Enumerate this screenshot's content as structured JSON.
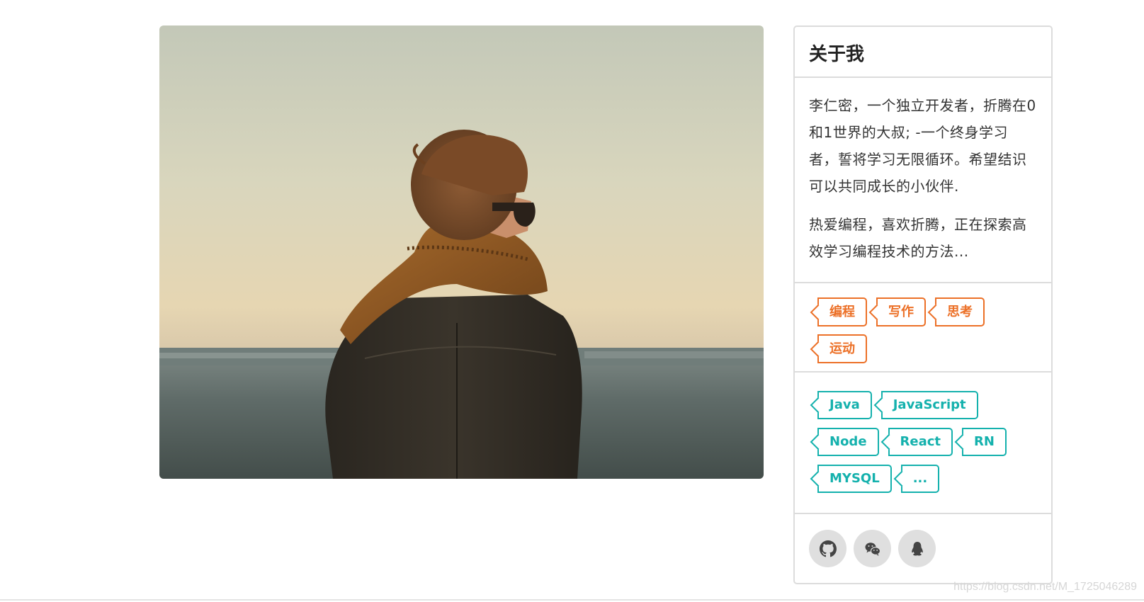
{
  "about": {
    "title": "关于我",
    "paragraphs": [
      "李仁密，一个独立开发者，折腾在0和1世界的大叔; -一个终身学习者，誓将学习无限循环。希望结识可以共同成长的小伙伴.",
      "热爱编程，喜欢折腾，正在探索高效学习编程技术的方法..."
    ]
  },
  "interest_tags": [
    "编程",
    "写作",
    "思考",
    "运动"
  ],
  "tech_tags": [
    "Java",
    "JavaScript",
    "Node",
    "React",
    "RN",
    "MYSQL",
    "..."
  ],
  "social": [
    {
      "icon": "github-icon"
    },
    {
      "icon": "wechat-icon"
    },
    {
      "icon": "qq-icon"
    }
  ],
  "watermark": "https://blog.csdn.net/M_1725046289",
  "colors": {
    "orange": "#ec7027",
    "teal": "#14b1ad",
    "border": "#dcdcdc"
  }
}
